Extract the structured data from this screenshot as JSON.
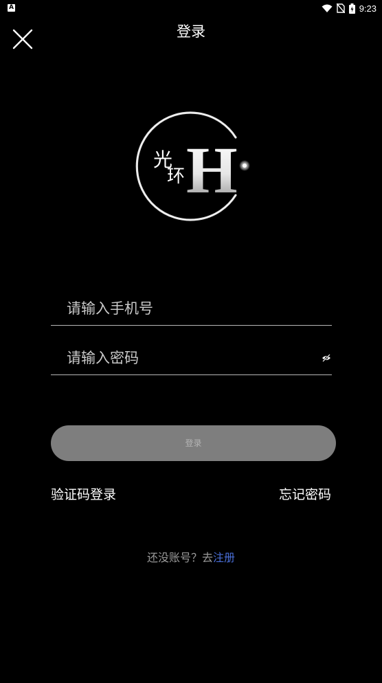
{
  "status_bar": {
    "app_icon_letter": "A",
    "time": "9:23"
  },
  "header": {
    "title": "登录"
  },
  "logo": {
    "chinese_top": "光",
    "chinese_bottom": "环",
    "letter": "H"
  },
  "form": {
    "phone_placeholder": "请输入手机号",
    "phone_value": "",
    "password_placeholder": "请输入密码",
    "password_value": ""
  },
  "actions": {
    "login_label": "登录",
    "sms_login_label": "验证码登录",
    "forgot_password_label": "忘记密码",
    "register_prompt": "还没账号？去",
    "register_link": "注册"
  },
  "colors": {
    "background": "#000000",
    "button_bg": "#7e7e7e",
    "link_accent": "#4a6fd8"
  }
}
